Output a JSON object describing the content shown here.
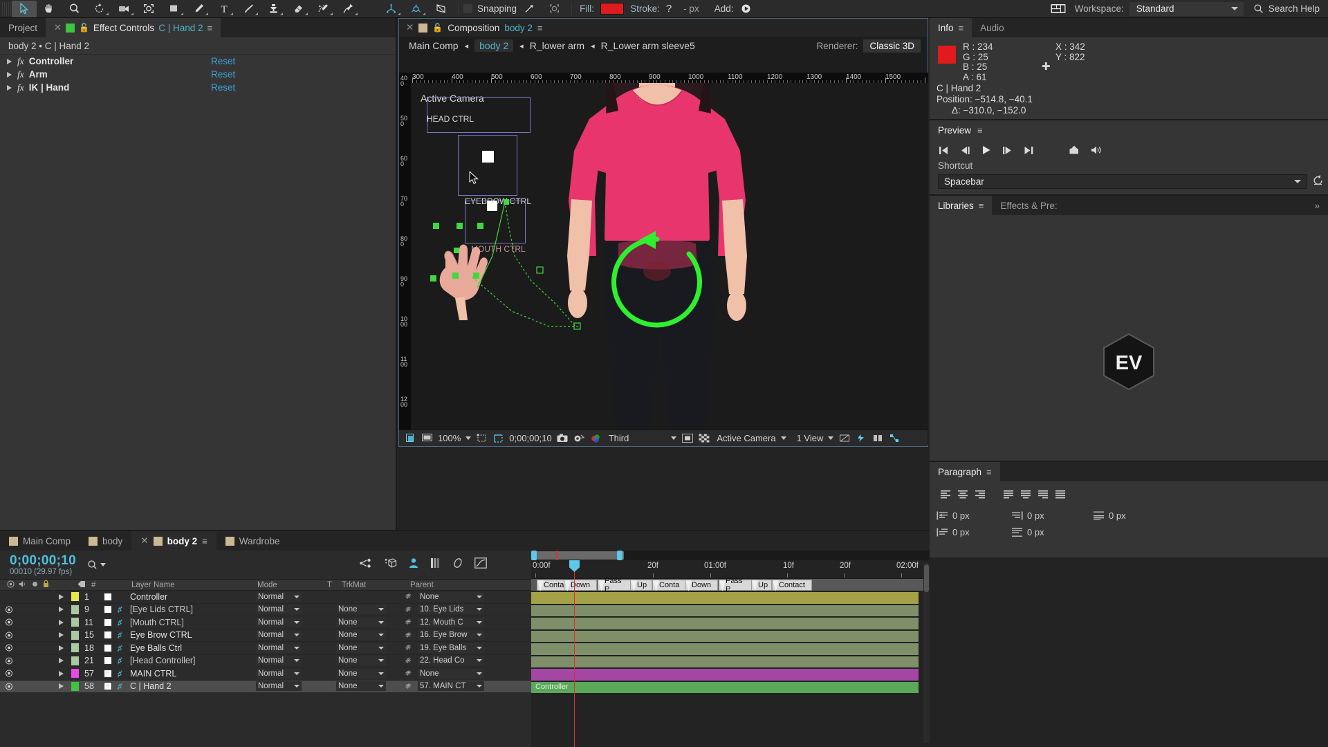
{
  "toolbar": {
    "tools": [
      "selection-tool",
      "hand-tool",
      "zoom-tool",
      "rotation-tool",
      "camera-tool",
      "pan-behind-tool",
      "shape-tool",
      "pen-tool",
      "type-tool",
      "brush-tool",
      "clone-stamp-tool",
      "eraser-tool",
      "roto-brush-tool",
      "puppet-pin-tool"
    ],
    "axis_tools": [
      "local-axis-mode",
      "world-axis-mode",
      "view-axis-mode"
    ],
    "snapping_label": "Snapping",
    "fill_label": "Fill:",
    "fill_color": "#e01b1b",
    "stroke_label": "Stroke:",
    "stroke_value": "?",
    "stroke_units": "- px",
    "add_label": "Add:",
    "workspace_label": "Workspace:",
    "workspace_value": "Standard",
    "search_help": "Search Help"
  },
  "effect_controls": {
    "tabs": [
      {
        "label": "Project",
        "active": false
      },
      {
        "label": "Effect Controls",
        "suffix": "C | Hand 2",
        "active": true
      }
    ],
    "path": "body 2 • C | Hand 2",
    "effects": [
      {
        "name": "Controller",
        "reset": "Reset"
      },
      {
        "name": "Arm",
        "reset": "Reset"
      },
      {
        "name": "IK | Hand",
        "reset": "Reset"
      }
    ]
  },
  "composition": {
    "tab_label": "Composition",
    "tab_comp": "body 2",
    "breadcrumb": [
      "Main Comp",
      "body 2",
      "R_lower arm",
      "R_Lower arm sleeve5"
    ],
    "breadcrumb_active_index": 1,
    "renderer_label": "Renderer:",
    "renderer_value": "Classic 3D",
    "ruler_h": [
      "300",
      "400",
      "500",
      "600",
      "700",
      "800",
      "900",
      "1000",
      "1100",
      "1200",
      "1300",
      "1400",
      "1500"
    ],
    "ruler_v": [
      "400",
      "500",
      "600",
      "700",
      "800",
      "900",
      "1000",
      "1100",
      "1200"
    ],
    "viewer_label": "Active Camera",
    "overlay_labels": [
      "HEAD CTRL",
      "EYEBROW CTRL",
      "MOUTH CTRL"
    ],
    "bottom_bar": {
      "zoom": "100%",
      "time": "0;00;00;10",
      "resolution": "Third",
      "camera": "Active Camera",
      "views": "1 View"
    }
  },
  "info": {
    "tabs": [
      {
        "label": "Info",
        "active": true
      },
      {
        "label": "Audio",
        "active": false
      }
    ],
    "swatch_color": "#e01b1b",
    "r": "R : 234",
    "g": "G : 25",
    "b": "B : 25",
    "a": "A : 61",
    "x": "X : 342",
    "y": "Y : 822",
    "layer_name": "C | Hand 2",
    "position": "Position: −514.8, −40.1",
    "delta": "Δ: −310.0, −152.0"
  },
  "preview": {
    "title": "Preview",
    "buttons": [
      "first-frame",
      "previous-frame",
      "play",
      "next-frame",
      "last-frame",
      "loop-toggle",
      "mute-toggle"
    ],
    "shortcut_label": "Shortcut",
    "shortcut_value": "Spacebar"
  },
  "libraries": {
    "tabs": [
      {
        "label": "Libraries",
        "active": true
      },
      {
        "label": "Effects & Pre:",
        "active": false
      }
    ],
    "overflow": "»",
    "logo_text": "EV"
  },
  "paragraph": {
    "title": "Paragraph",
    "align_buttons": [
      "align-left",
      "align-center",
      "align-right",
      "justify-last-left",
      "justify-last-center",
      "justify-last-right",
      "justify-all"
    ],
    "fields": [
      {
        "icon": "indent-left",
        "value": "0 px"
      },
      {
        "icon": "indent-right",
        "value": "0 px"
      },
      {
        "icon": "space-before",
        "value": "0 px"
      },
      {
        "icon": "indent-first-line",
        "value": "0 px"
      },
      {
        "icon": "space-after",
        "value": "0 px"
      }
    ]
  },
  "timeline": {
    "tabs": [
      {
        "label": "Main Comp",
        "active": false
      },
      {
        "label": "body",
        "active": false
      },
      {
        "label": "body 2",
        "active": true
      },
      {
        "label": "Wardrobe",
        "active": false
      }
    ],
    "current_time": "0;00;00;10",
    "frame_info": "00010 (29.97 fps)",
    "columns": [
      "Layer Name",
      "Mode",
      "T",
      "TrkMat",
      "Parent"
    ],
    "layers": [
      {
        "num": "1",
        "name": "Controller",
        "color": "#e8e84a",
        "visible": false,
        "shy": false,
        "threeD": false,
        "mode": "Normal",
        "trkmat": "",
        "parent": "None",
        "selected": false,
        "bracketed": false
      },
      {
        "num": "9",
        "name": "[Eye Lids CTRL]",
        "color": "#a9c9a0",
        "visible": true,
        "threeD": true,
        "mode": "Normal",
        "trkmat": "None",
        "parent": "10. Eye Lids",
        "selected": false,
        "bracketed": true
      },
      {
        "num": "11",
        "name": "[Mouth CTRL]",
        "color": "#a9c9a0",
        "visible": true,
        "threeD": true,
        "mode": "Normal",
        "trkmat": "None",
        "parent": "12. Mouth C",
        "selected": false,
        "bracketed": true
      },
      {
        "num": "15",
        "name": "Eye Brow CTRL",
        "color": "#a9c9a0",
        "visible": true,
        "threeD": true,
        "mode": "Normal",
        "trkmat": "None",
        "parent": "16. Eye Brow",
        "selected": false,
        "bracketed": false
      },
      {
        "num": "18",
        "name": "Eye Balls Ctrl",
        "color": "#a9c9a0",
        "visible": true,
        "threeD": true,
        "mode": "Normal",
        "trkmat": "None",
        "parent": "19. Eye Balls",
        "selected": false,
        "bracketed": false
      },
      {
        "num": "21",
        "name": "[Head Controller]",
        "color": "#a9c9a0",
        "visible": true,
        "threeD": true,
        "mode": "Normal",
        "trkmat": "None",
        "parent": "22. Head Co",
        "selected": false,
        "bracketed": true
      },
      {
        "num": "57",
        "name": "MAIN CTRL",
        "color": "#e84ae8",
        "visible": true,
        "threeD": true,
        "star": true,
        "mode": "Normal",
        "trkmat": "None",
        "parent": "None",
        "selected": false,
        "bracketed": false
      },
      {
        "num": "58",
        "name": "C | Hand 2",
        "color": "#3ec43e",
        "visible": true,
        "threeD": true,
        "star": true,
        "mode": "Normal",
        "trkmat": "None",
        "parent": "57. MAIN CT",
        "selected": true,
        "bracketed": false
      }
    ],
    "ruler_ticks": [
      "0:00f",
      "20f",
      "01:00f",
      "10f",
      "20f",
      "02:00f"
    ],
    "markers": [
      "Conta",
      "Down",
      "Pass P",
      "Up",
      "Conta",
      "Down",
      "Pass P",
      "Up",
      "Contact"
    ]
  }
}
